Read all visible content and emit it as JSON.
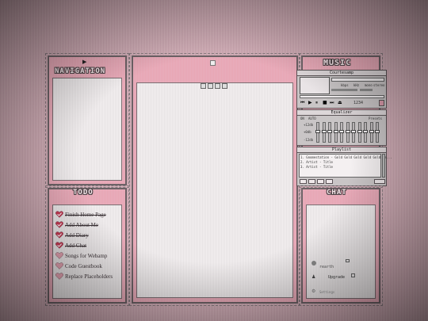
{
  "nav": {
    "title": "NAVIGATION",
    "arrow": "▶"
  },
  "todo": {
    "title": "TODO",
    "items": [
      {
        "label": "Finish Home Page",
        "done": true
      },
      {
        "label": "Add About Me",
        "done": true
      },
      {
        "label": "Add Diary",
        "done": true
      },
      {
        "label": "Add Chat",
        "done": true
      },
      {
        "label": "Songs for Webamp",
        "done": false
      },
      {
        "label": "Code Guestbook",
        "done": false
      },
      {
        "label": "Replace Placeholders",
        "done": false
      }
    ]
  },
  "music": {
    "title": "MUSIC"
  },
  "chat": {
    "title": "CHAT",
    "user": "rearth",
    "upgrade": "Upgrade",
    "settings": "Settings"
  },
  "webamp": {
    "main_title": "Courtesamp",
    "kbps": "kbps",
    "khz": "kHz",
    "mono": "mono",
    "stereo": "stereo",
    "time": "1234",
    "eq_title": "Equalizer",
    "eq_on": "ON",
    "eq_auto": "AUTO",
    "eq_presets": "Presets",
    "playlist_title": "Playlist",
    "playlist_items": [
      "1. Gnomestation - Gold Gold Gold Gold Gold (e...",
      "2. Artist - Title",
      "3. Artist - Title"
    ],
    "eq_db": [
      "+12db",
      "+0db",
      "-12db"
    ]
  },
  "colors": {
    "accent": "#e7a5b4",
    "frame": "#6d6266",
    "paper": "#f3eff0"
  }
}
